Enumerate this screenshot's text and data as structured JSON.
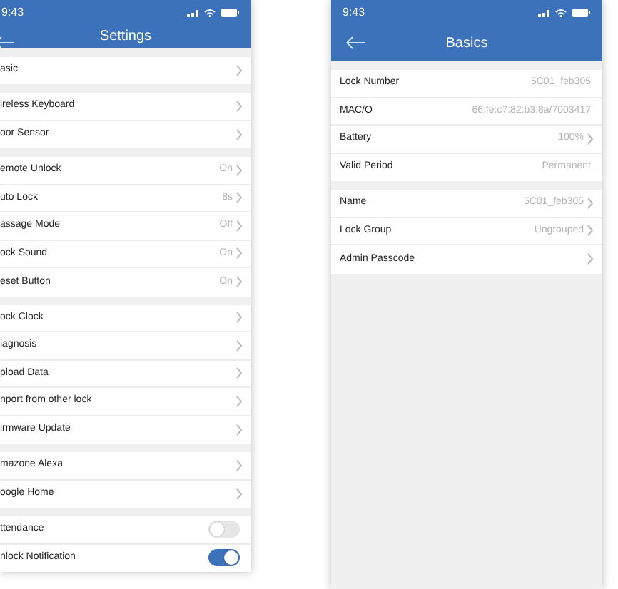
{
  "screens": [
    {
      "time": "9:43",
      "title": "Settings",
      "groups": [
        {
          "rows": [
            {
              "label": "asic",
              "kind": "link"
            }
          ]
        },
        {
          "rows": [
            {
              "label": "ireless Keyboard",
              "kind": "link"
            },
            {
              "label": "oor Sensor",
              "kind": "link"
            }
          ]
        },
        {
          "rows": [
            {
              "label": "emote Unlock",
              "value": "On",
              "kind": "link"
            },
            {
              "label": "uto Lock",
              "value": "8s",
              "kind": "link"
            },
            {
              "label": "assage Mode",
              "value": "Off",
              "kind": "link"
            },
            {
              "label": "ock Sound",
              "value": "On",
              "kind": "link"
            },
            {
              "label": "eset Button",
              "value": "On",
              "kind": "link"
            }
          ]
        },
        {
          "rows": [
            {
              "label": "ock Clock",
              "kind": "link"
            },
            {
              "label": "iagnosis",
              "kind": "link"
            },
            {
              "label": "pload Data",
              "kind": "link"
            },
            {
              "label": "nport from other lock",
              "kind": "link"
            },
            {
              "label": "irmware Update",
              "kind": "link"
            }
          ]
        },
        {
          "rows": [
            {
              "label": "mazone Alexa",
              "kind": "link"
            },
            {
              "label": "oogle Home",
              "kind": "link"
            }
          ]
        },
        {
          "rows": [
            {
              "label": "ttendance",
              "kind": "toggle",
              "on": false
            },
            {
              "label": "nlock Notification",
              "kind": "toggle",
              "on": true
            }
          ]
        }
      ]
    },
    {
      "time": "9:43",
      "title": "Basics",
      "groups": [
        {
          "rows": [
            {
              "label": "Lock Number",
              "value": "5C01_feb305",
              "kind": "info"
            },
            {
              "label": "MAC/O",
              "value": "66:fe:c7:82:b3:8a/7003417",
              "kind": "info"
            },
            {
              "label": "Battery",
              "value": "100%",
              "kind": "link"
            },
            {
              "label": "Valid Period",
              "value": "Permanent",
              "kind": "info"
            }
          ]
        },
        {
          "rows": [
            {
              "label": "Name",
              "value": "5C01_feb305",
              "kind": "link"
            },
            {
              "label": "Lock Group",
              "value": "Ungrouped",
              "kind": "link"
            },
            {
              "label": "Admin Passcode",
              "kind": "link"
            }
          ]
        }
      ]
    }
  ]
}
